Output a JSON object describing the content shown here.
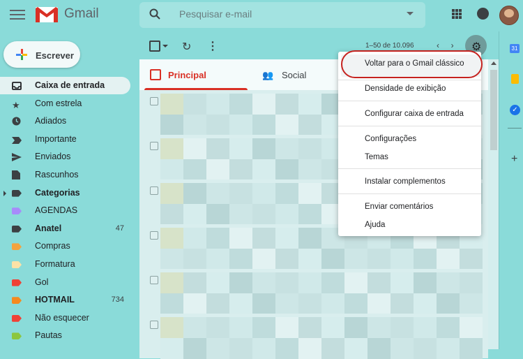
{
  "header": {
    "app_name": "Gmail",
    "search_placeholder": "Pesquisar e-mail"
  },
  "compose": {
    "label": "Escrever"
  },
  "sidebar": {
    "items": [
      {
        "label": "Caixa de entrada",
        "icon": "inbox-icon",
        "active": true,
        "bold": true
      },
      {
        "label": "Com estrela",
        "icon": "star-icon"
      },
      {
        "label": "Adiados",
        "icon": "clock-icon"
      },
      {
        "label": "Importante",
        "icon": "important-icon"
      },
      {
        "label": "Enviados",
        "icon": "send-icon"
      },
      {
        "label": "Rascunhos",
        "icon": "draft-icon"
      },
      {
        "label": "Categorias",
        "icon": "label-icon",
        "bold": true,
        "expandable": true
      },
      {
        "label": "AGENDAS",
        "icon": "label-icon",
        "color": "#a78bfa"
      },
      {
        "label": "Anatel",
        "icon": "label-icon",
        "color": "#3c4043",
        "bold": true,
        "count": "47"
      },
      {
        "label": "Compras",
        "icon": "label-icon",
        "color": "#f4a340"
      },
      {
        "label": "Formatura",
        "icon": "label-icon",
        "color": "#fde2a7"
      },
      {
        "label": "Gol",
        "icon": "label-icon",
        "color": "#ef4136"
      },
      {
        "label": "HOTMAIL",
        "icon": "label-icon",
        "color": "#f58a1f",
        "bold": true,
        "count": "734"
      },
      {
        "label": "Não esquecer",
        "icon": "label-icon",
        "color": "#ef4136"
      },
      {
        "label": "Pautas",
        "icon": "label-icon",
        "color": "#8cc63f"
      }
    ]
  },
  "toolbar": {
    "pager": "1–50 de 10.096"
  },
  "tabs": [
    {
      "label": "Principal",
      "icon": "inbox-icon",
      "active": true
    },
    {
      "label": "Social",
      "icon": "people-icon"
    }
  ],
  "settings_menu": {
    "items": [
      "Voltar para o Gmail clássico",
      "Densidade de exibição",
      "Configurar caixa de entrada",
      "Configurações",
      "Temas",
      "Instalar complementos",
      "Enviar comentários",
      "Ajuda"
    ]
  },
  "right_rail": {
    "calendar_day": "31"
  },
  "colors": {
    "accent": "#d93025",
    "background": "#8adbd9"
  }
}
